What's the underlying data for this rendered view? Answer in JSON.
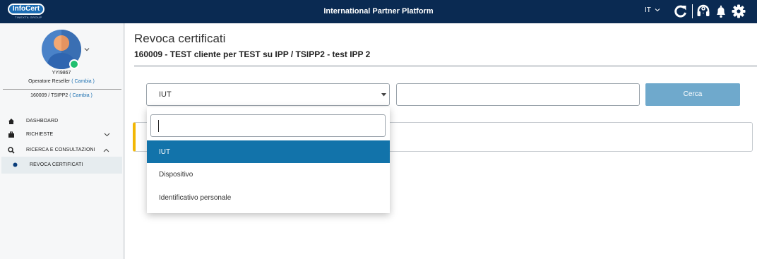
{
  "topbar": {
    "logo_text": "InfoCert",
    "logo_subtext": "TINEXTA GROUP",
    "app_title": "International Partner Platform",
    "language": "IT",
    "icons": [
      "refresh-icon",
      "headset-icon",
      "bell-icon",
      "gear-icon"
    ]
  },
  "user": {
    "code": "YYI9867",
    "role": "Operatore Reseller",
    "role_change": "( Cambia )",
    "company": "160009  / TSIPP2",
    "company_change": "( Cambia )",
    "status_color": "#20c070"
  },
  "nav": {
    "items": [
      {
        "label": "DASHBOARD",
        "icon": "home-icon"
      },
      {
        "label": "RICHIESTE",
        "icon": "briefcase-icon"
      },
      {
        "label": "RICERCA E CONSULTAZIONI",
        "icon": "search-icon"
      },
      {
        "label": "REVOCA CERTIFICATI",
        "icon": "dot-icon"
      }
    ]
  },
  "page": {
    "title": "Revoca certificati",
    "subtitle": "160009 - TEST cliente per TEST su IPP  / TSIPP2 - test IPP 2"
  },
  "search": {
    "selected_type": "IUT",
    "value": "",
    "button_label": "Cerca"
  },
  "dropdown": {
    "filter_value": "",
    "options": [
      "IUT",
      "Dispositivo",
      "Identificativo personale"
    ],
    "selected_index": 0
  },
  "colors": {
    "topbar": "#0a2a52",
    "accent": "#1273aa",
    "button": "#6fa9cc",
    "alert_border": "#f2b705"
  }
}
